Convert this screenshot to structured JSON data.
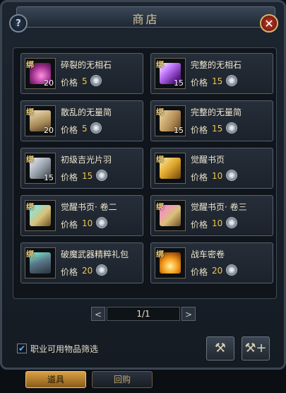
{
  "window": {
    "title": "商店",
    "help_glyph": "?",
    "close_glyph": "✕"
  },
  "colors": {
    "price": "#f1c64d",
    "bind_tag": "#f2d27a",
    "active_tab": "#d8a145"
  },
  "items": [
    {
      "name": "碎裂的无相石",
      "bind": "绑",
      "qty": "20",
      "price_label": "价格",
      "price": "5",
      "icon": "pink-shard-icon",
      "art": "radial-gradient(circle at 55% 60%,#ff8fe0,#9a2d8a 55%,#2a0f2a)"
    },
    {
      "name": "完整的无相石",
      "bind": "绑",
      "qty": "15",
      "price_label": "价格",
      "price": "15",
      "icon": "purple-crystal-icon",
      "art": "linear-gradient(135deg,#ffffff 0%,#c67bff 35%,#5a1a8a 80%)"
    },
    {
      "name": "散乱的无量简",
      "bind": "绑",
      "qty": "20",
      "price_label": "价格",
      "price": "5",
      "icon": "scroll-fragment-icon",
      "art": "linear-gradient(160deg,#f1e1b6,#a88a58 60%,#4a3a22)"
    },
    {
      "name": "完整的无量简",
      "bind": "绑",
      "qty": "15",
      "price_label": "价格",
      "price": "15",
      "icon": "bamboo-scroll-icon",
      "art": "linear-gradient(120deg,#efd9a4,#b9925a 55%,#5e4624)"
    },
    {
      "name": "初级吉光片羽",
      "bind": "绑",
      "qty": "15",
      "price_label": "价格",
      "price": "15",
      "icon": "feather-icon",
      "art": "linear-gradient(135deg,#f2f4f7,#9aa3ad 50%,#3b4048)"
    },
    {
      "name": "觉醒书页",
      "bind": "绑",
      "qty": "",
      "price_label": "价格",
      "price": "10",
      "icon": "golden-page-icon",
      "art": "linear-gradient(135deg,#fff0a8,#e0a52a 50%,#6a4510)"
    },
    {
      "name": "觉醒书页· 卷二",
      "bind": "绑",
      "qty": "",
      "price_label": "价格",
      "price": "10",
      "icon": "teal-page-icon",
      "art": "linear-gradient(135deg,#6ff2ff,#d8c27a 55%,#6a5020)"
    },
    {
      "name": "觉醒书页· 卷三",
      "bind": "绑",
      "qty": "",
      "price_label": "价格",
      "price": "10",
      "icon": "magenta-page-icon",
      "art": "linear-gradient(135deg,#ff7ae8,#dcc07a 55%,#6a5020)"
    },
    {
      "name": "破魔武器精粹礼包",
      "bind": "绑",
      "qty": "",
      "price_label": "价格",
      "price": "20",
      "icon": "treasure-chest-icon",
      "art": "linear-gradient(160deg,#7ef0d0,#5a7a8a 45%,#2a323c)"
    },
    {
      "name": "战车密卷",
      "bind": "绑",
      "qty": "",
      "price_label": "价格",
      "price": "20",
      "icon": "fire-scroll-icon",
      "art": "radial-gradient(circle at 50% 65%,#fff3a0,#f59a1a 45%,#6a2a08)"
    }
  ],
  "pager": {
    "prev": "<",
    "next": ">",
    "page": "1/1"
  },
  "filter": {
    "label": "职业可用物品筛选",
    "checked": true,
    "check_glyph": "✔"
  },
  "toolbar": {
    "repair_glyph": "⚒",
    "repair_all_glyph": "⚒+"
  },
  "tabs": [
    {
      "label": "道具",
      "active": true
    },
    {
      "label": "回购",
      "active": false
    }
  ]
}
